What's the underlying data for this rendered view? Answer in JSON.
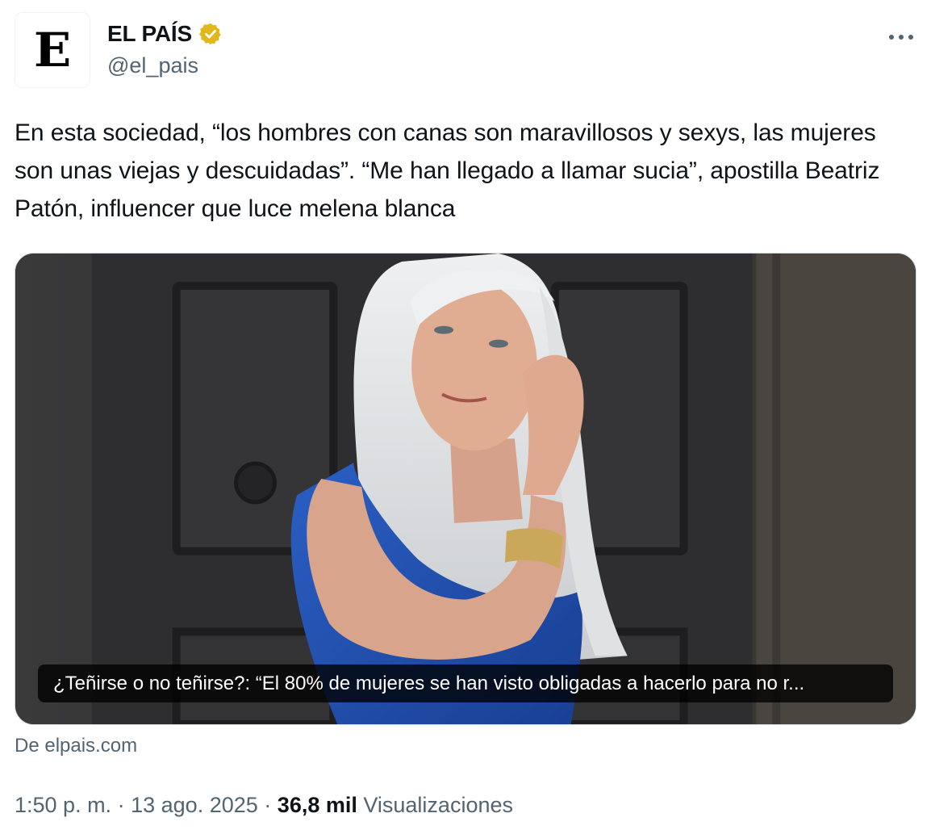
{
  "author": {
    "avatar_letter": "E",
    "display_name": "EL PAÍS",
    "handle": "@el_pais",
    "verified_icon": "verified-badge-gold"
  },
  "tweet": {
    "text": "En esta sociedad, “los hombres con canas son maravillosos y sexys, las mujeres son unas viejas y descuidadas”. “Me han llegado a llamar sucia”, apostilla Beatriz Patón, influencer que luce melena blanca"
  },
  "card": {
    "caption": "¿Teñirse o no teñirse?: “El 80% de mujeres se han visto obligadas a hacerlo para no r...",
    "source": "De elpais.com"
  },
  "meta": {
    "time": "1:50 p. m.",
    "separator": "·",
    "date": "13 ago. 2025",
    "views_count": "36,8 mil",
    "views_label": "Visualizaciones"
  },
  "colors": {
    "text_primary": "#0f1419",
    "text_secondary": "#536471",
    "verified_gold": "#e2b719",
    "border": "#cfd9de"
  }
}
